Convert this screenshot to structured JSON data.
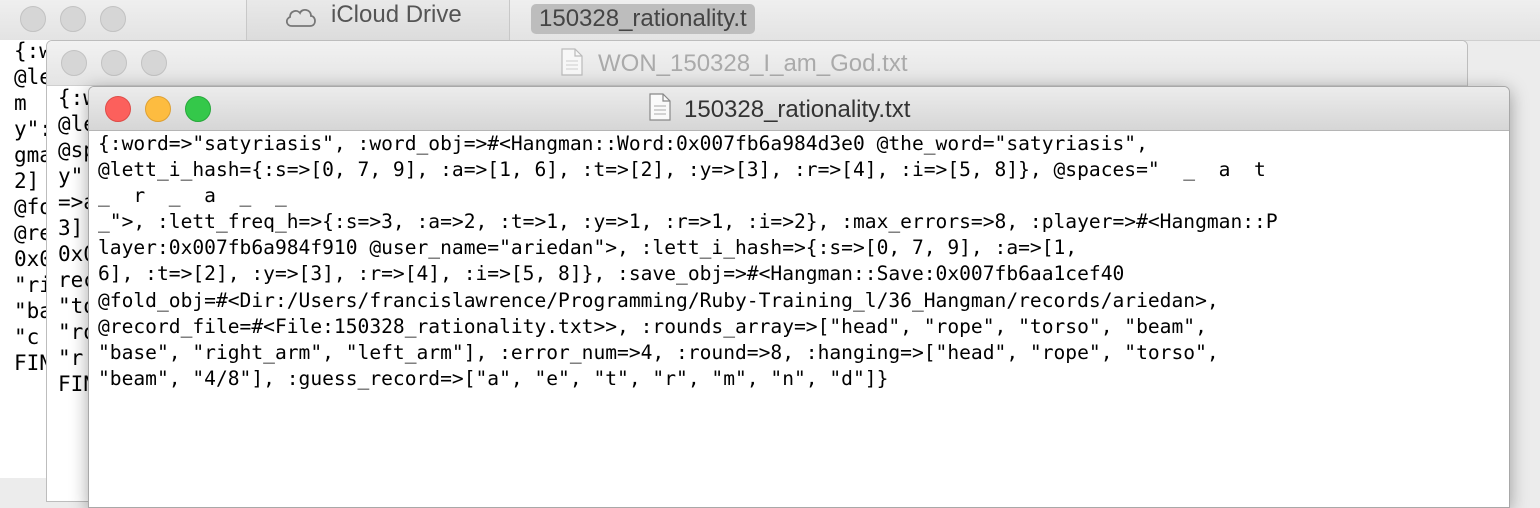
{
  "finder": {
    "tab_icloud_label": "iCloud Drive",
    "tab_file_label": "150328_rationality.t",
    "cloud_icon": "cloud-icon",
    "left_column_lines": [
      "{:w",
      "@le",
      "m",
      "y\":",
      "gma",
      "2] ",
      "@fo",
      "@re",
      "0x0",
      "\"ri",
      "\"ba",
      "\"c",
      "FIN"
    ]
  },
  "middle_window": {
    "title": "WON_150328_I_am_God.txt",
    "left_column_lines": [
      "{:w",
      "@le",
      "@sp",
      "y\":",
      "=>a",
      "3] ",
      "0x0",
      "rec",
      "\"to",
      "\"ro",
      "\"r",
      "FIN"
    ]
  },
  "front_window": {
    "title": "150328_rationality.txt",
    "text_lines": [
      "{:word=>\"satyriasis\", :word_obj=>#<Hangman::Word:0x007fb6a984d3e0 @the_word=\"satyriasis\",",
      "@lett_i_hash={:s=>[0, 7, 9], :a=>[1, 6], :t=>[2], :y=>[3], :r=>[4], :i=>[5, 8]}, @spaces=\"  _  a  t",
      "_  r  _  a  _  _",
      "_\">, :lett_freq_h=>{:s=>3, :a=>2, :t=>1, :y=>1, :r=>1, :i=>2}, :max_errors=>8, :player=>#<Hangman::P",
      "layer:0x007fb6a984f910 @user_name=\"ariedan\">, :lett_i_hash=>{:s=>[0, 7, 9], :a=>[1,",
      "6], :t=>[2], :y=>[3], :r=>[4], :i=>[5, 8]}, :save_obj=>#<Hangman::Save:0x007fb6aa1cef40",
      "@fold_obj=#<Dir:/Users/francislawrence/Programming/Ruby-Training_l/36_Hangman/records/ariedan>,",
      "@record_file=#<File:150328_rationality.txt>>, :rounds_array=>[\"head\", \"rope\", \"torso\", \"beam\",",
      "\"base\", \"right_arm\", \"left_arm\"], :error_num=>4, :round=>8, :hanging=>[\"head\", \"rope\", \"torso\",",
      "\"beam\", \"4/8\"], :guess_record=>[\"a\", \"e\", \"t\", \"r\", \"m\", \"n\", \"d\"]}"
    ]
  }
}
